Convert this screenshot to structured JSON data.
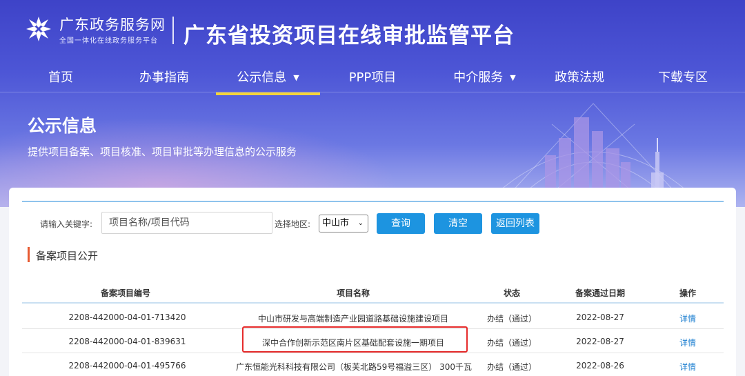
{
  "header": {
    "brand_name": "广东政务服务网",
    "brand_sub": "全国一体化在线政务服务平台",
    "platform_title": "广东省投资项目在线审批监管平台"
  },
  "nav": {
    "items": [
      {
        "label": "首页"
      },
      {
        "label": "办事指南"
      },
      {
        "label": "公示信息",
        "active": true,
        "dropdown": true
      },
      {
        "label": "PPP项目"
      },
      {
        "label": "中介服务",
        "dropdown": true
      },
      {
        "label": "政策法规"
      },
      {
        "label": "下载专区"
      }
    ]
  },
  "section": {
    "title": "公示信息",
    "description": "提供项目备案、项目核准、项目审批等办理信息的公示服务"
  },
  "search": {
    "keyword_label": "请输入关键字:",
    "keyword_placeholder": "项目名称/项目代码",
    "region_label": "选择地区:",
    "region_value": "中山市",
    "query_button": "查询",
    "clear_button": "清空",
    "back_button": "返回列表"
  },
  "list": {
    "subhead": "备案项目公开",
    "columns": [
      "备案项目编号",
      "项目名称",
      "状态",
      "备案通过日期",
      "操作"
    ],
    "rows": [
      {
        "code": "2208-442000-04-01-713420",
        "name": "中山市研发与高端制造产业园道路基础设施建设项目",
        "status": "办结（通过）",
        "date": "2022-08-27",
        "action": "详情"
      },
      {
        "code": "2208-442000-04-01-839631",
        "name": "深中合作创新示范区南片区基础配套设施一期项目",
        "status": "办结（通过）",
        "date": "2022-08-27",
        "action": "详情",
        "highlighted": true
      },
      {
        "code": "2208-442000-04-01-495766",
        "name": "广东恒能光科科技有限公司（板芙北路59号福溢三区） 300千瓦",
        "status": "办结（通过）",
        "date": "2022-08-26",
        "action": "详情"
      }
    ]
  },
  "colors": {
    "accent": "#1d94e0",
    "nav_active": "#f5d43a",
    "highlight_box": "#e62b2b",
    "subhead_marker": "#e75a32",
    "link": "#1d7fd0"
  },
  "icons": {
    "logo": "guangdong-gov-logo-icon",
    "dropdown": "caret-down-icon"
  }
}
